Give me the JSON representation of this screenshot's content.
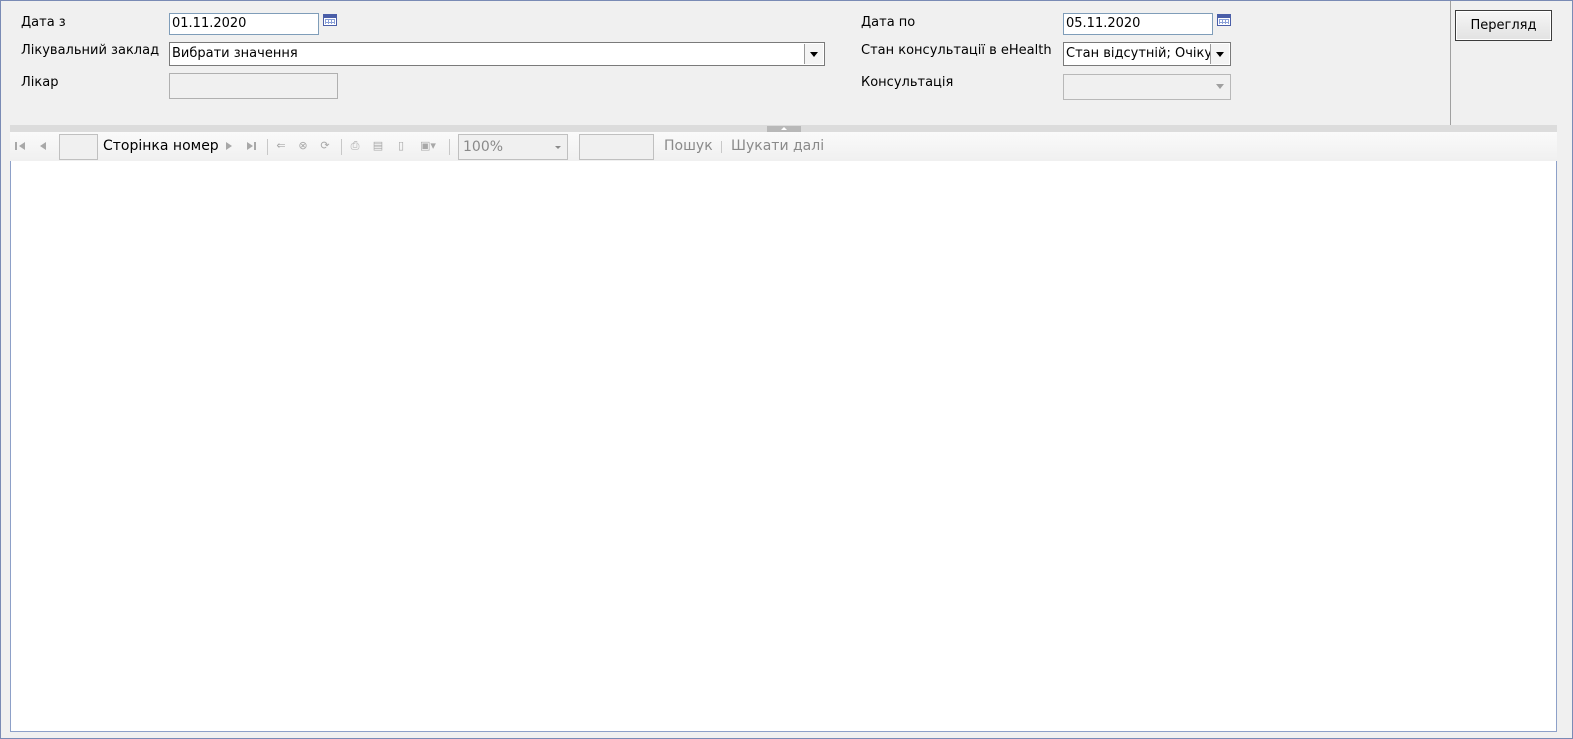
{
  "params": {
    "date_from_label": "Дата з",
    "date_from_value": "01.11.2020",
    "facility_label": "Лікувальний заклад",
    "facility_value": "Вибрати значення",
    "doctor_label": "Лікар",
    "doctor_value": "",
    "date_to_label": "Дата по",
    "date_to_value": "05.11.2020",
    "status_label": "Стан консультації в eHealth",
    "status_value": "Стан відсутній; Очікує",
    "consult_label": "Консультація",
    "consult_value": ""
  },
  "view_button": "Перегляд",
  "toolbar": {
    "page_number": "",
    "page_label": "Сторінка номер",
    "zoom": "100%",
    "search_value": "",
    "find_label": "Пошук",
    "find_next_label": "Шукати далі"
  },
  "icons": {
    "first_page": "first-page-icon",
    "prev_page": "prev-page-icon",
    "next_page": "next-page-icon",
    "last_page": "last-page-icon",
    "back": "back-icon",
    "stop": "stop-icon",
    "refresh": "refresh-icon",
    "print": "print-icon",
    "print_layout": "print-layout-icon",
    "page_setup": "page-setup-icon",
    "export": "export-icon",
    "calendar": "calendar-icon"
  }
}
